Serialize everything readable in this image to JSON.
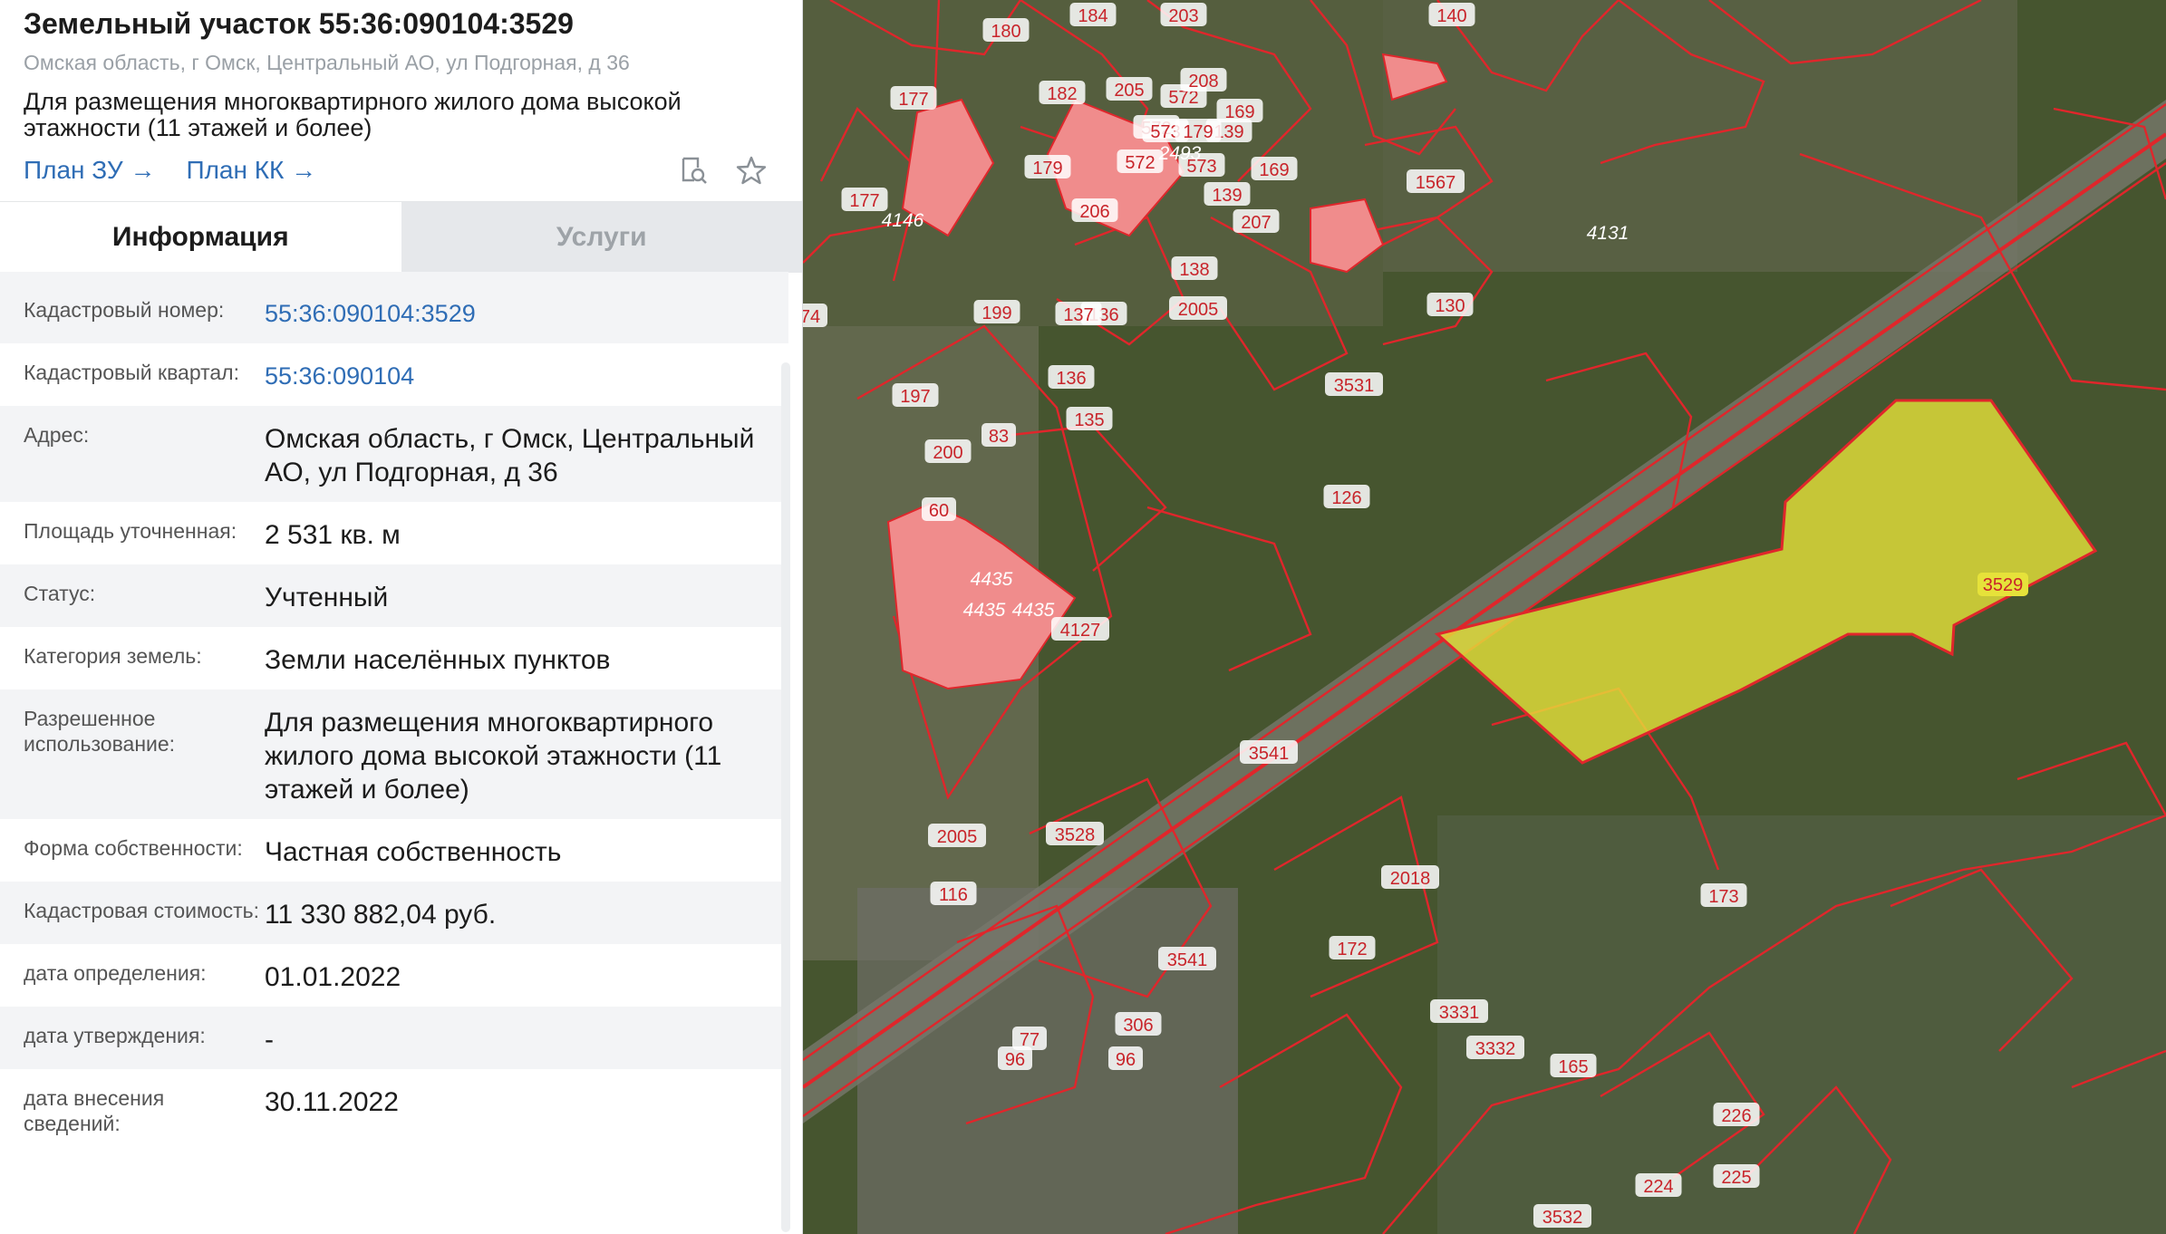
{
  "header": {
    "title": "Земельный участок 55:36:090104:3529",
    "address": "Омская область, г Омск, Центральный АО, ул Подгорная, д 36",
    "purpose": "Для размещения многоквартирного жилого дома высокой этажности (11 этажей и более)",
    "link_plan_zu": "План ЗУ →",
    "link_plan_kk": "План КК →"
  },
  "icons": {
    "search": "document-search-icon",
    "favorite": "star-icon"
  },
  "tabs": [
    {
      "label": "Информация",
      "active": true
    },
    {
      "label": "Услуги",
      "active": false
    }
  ],
  "info": {
    "cadastral_number": {
      "label": "Кадастровый номер:",
      "value": "55:36:090104:3529"
    },
    "cadastral_quarter": {
      "label": "Кадастровый квартал:",
      "value": "55:36:090104"
    },
    "address": {
      "label": "Адрес:",
      "value": "Омская область, г Омск, Центральный АО, ул Подгорная, д 36"
    },
    "area": {
      "label": "Площадь уточненная:",
      "value": "2 531 кв. м"
    },
    "status": {
      "label": "Статус:",
      "value": "Учтенный"
    },
    "category": {
      "label": "Категория земель:",
      "value": "Земли населённых пунктов"
    },
    "permitted_use": {
      "label": "Разрешенное использование:",
      "value": "Для размещения многоквартирного жилого дома высокой этажности (11 этажей и более)"
    },
    "ownership": {
      "label": "Форма собственности:",
      "value": "Частная собственность"
    },
    "cost": {
      "label": "Кадастровая стоимость:",
      "value": "11 330 882,04 руб."
    },
    "date_determined": {
      "label": "дата определения:",
      "value": "01.01.2022"
    },
    "date_approved": {
      "label": "дата утверждения:",
      "value": "-"
    },
    "date_entered": {
      "label": "дата внесения сведений:",
      "value": "30.11.2022"
    }
  },
  "map": {
    "selected_parcel": "3529",
    "building_labels": [
      "4435",
      "4435",
      "4435",
      "2493",
      "4131",
      "4146"
    ],
    "parcel_labels": [
      "180",
      "184",
      "203",
      "140",
      "177",
      "182",
      "205",
      "572",
      "572",
      "208",
      "139",
      "169",
      "573",
      "573",
      "179",
      "179",
      "177",
      "206",
      "572",
      "139",
      "169",
      "1567",
      "207",
      "138",
      "130",
      "199",
      "136",
      "137",
      "2005",
      "74",
      "3531",
      "197",
      "135",
      "136",
      "83",
      "200",
      "126",
      "60",
      "4127",
      "3541",
      "3528",
      "2005",
      "2018",
      "116",
      "173",
      "3541",
      "172",
      "306",
      "96",
      "77",
      "3331",
      "3332",
      "96",
      "165",
      "226",
      "225",
      "224",
      "3532"
    ],
    "colors": {
      "boundary": "#e0262b",
      "selected_fill": "#e6e23a",
      "building_fill": "#f08c8c",
      "label_text": "#c8242a"
    }
  }
}
